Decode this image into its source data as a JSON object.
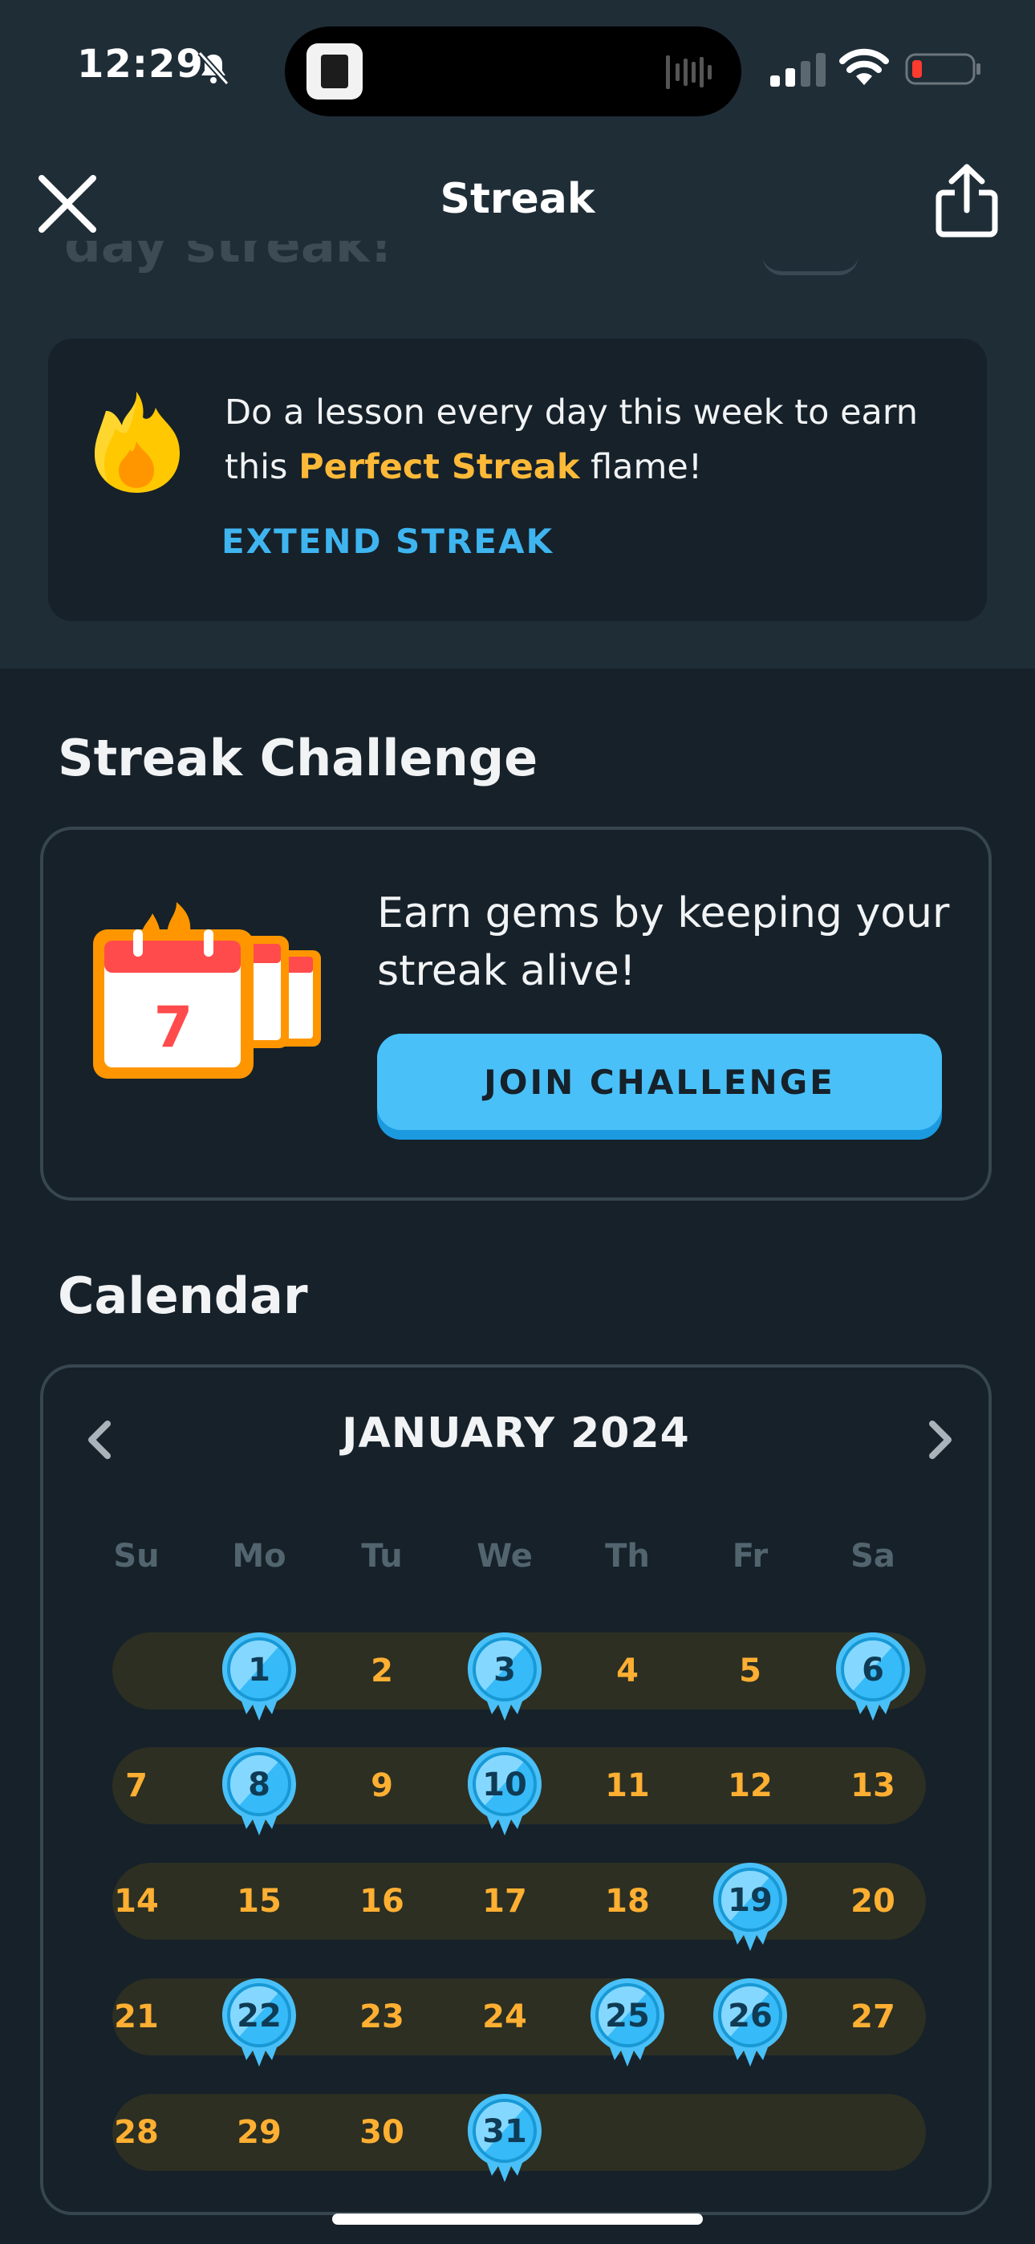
{
  "status_bar": {
    "time": "12:29"
  },
  "header": {
    "title": "Streak",
    "obscured_text": "day streak!"
  },
  "perfect_streak": {
    "text_before": "Do a lesson every day this week to earn this ",
    "highlight": "Perfect Streak",
    "text_after": " flame!",
    "link": "EXTEND STREAK"
  },
  "challenge": {
    "section_title": "Streak Challenge",
    "illustration_number": "7",
    "description": "Earn gems by keeping your streak alive!",
    "button": "JOIN CHALLENGE"
  },
  "calendar": {
    "section_title": "Calendar",
    "month": "JANUARY 2024",
    "weekdays": [
      "Su",
      "Mo",
      "Tu",
      "We",
      "Th",
      "Fr",
      "Sa"
    ],
    "weeks": [
      [
        null,
        "1",
        "2",
        "3",
        "4",
        "5",
        "6"
      ],
      [
        "7",
        "8",
        "9",
        "10",
        "11",
        "12",
        "13"
      ],
      [
        "14",
        "15",
        "16",
        "17",
        "18",
        "19",
        "20"
      ],
      [
        "21",
        "22",
        "23",
        "24",
        "25",
        "26",
        "27"
      ],
      [
        "28",
        "29",
        "30",
        "31",
        null,
        null,
        null
      ]
    ],
    "completed_days": [
      "1",
      "3",
      "6",
      "8",
      "10",
      "19",
      "22",
      "25",
      "26",
      "31"
    ]
  },
  "colors": {
    "background": "#16212a",
    "top_panel": "#1f2d37",
    "accent_blue": "#49c0f8",
    "link_blue": "#3fb5f0",
    "streak_orange": "#ffaf32",
    "band": "#2c2f22"
  },
  "icons": {
    "close": "close-icon",
    "share": "share-icon",
    "flame": "flame-icon",
    "prev": "chevron-left-icon",
    "next": "chevron-right-icon"
  }
}
